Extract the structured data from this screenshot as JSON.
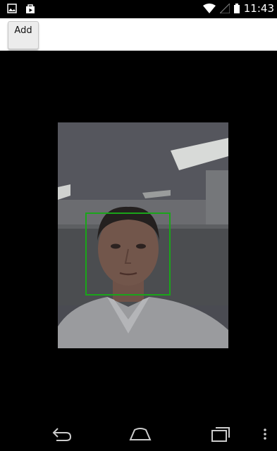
{
  "status_bar": {
    "time": "11:43",
    "left_icons": [
      "image-notification-icon",
      "store-notification-icon"
    ],
    "right_icons": [
      "wifi-icon",
      "signal-icon",
      "battery-icon"
    ]
  },
  "action_bar": {
    "add_label": "Add"
  },
  "camera": {
    "face_detection_color": "#1aa51a"
  },
  "nav_bar": {
    "buttons": [
      "back-icon",
      "home-icon",
      "recent-apps-icon",
      "overflow-menu-icon"
    ]
  }
}
